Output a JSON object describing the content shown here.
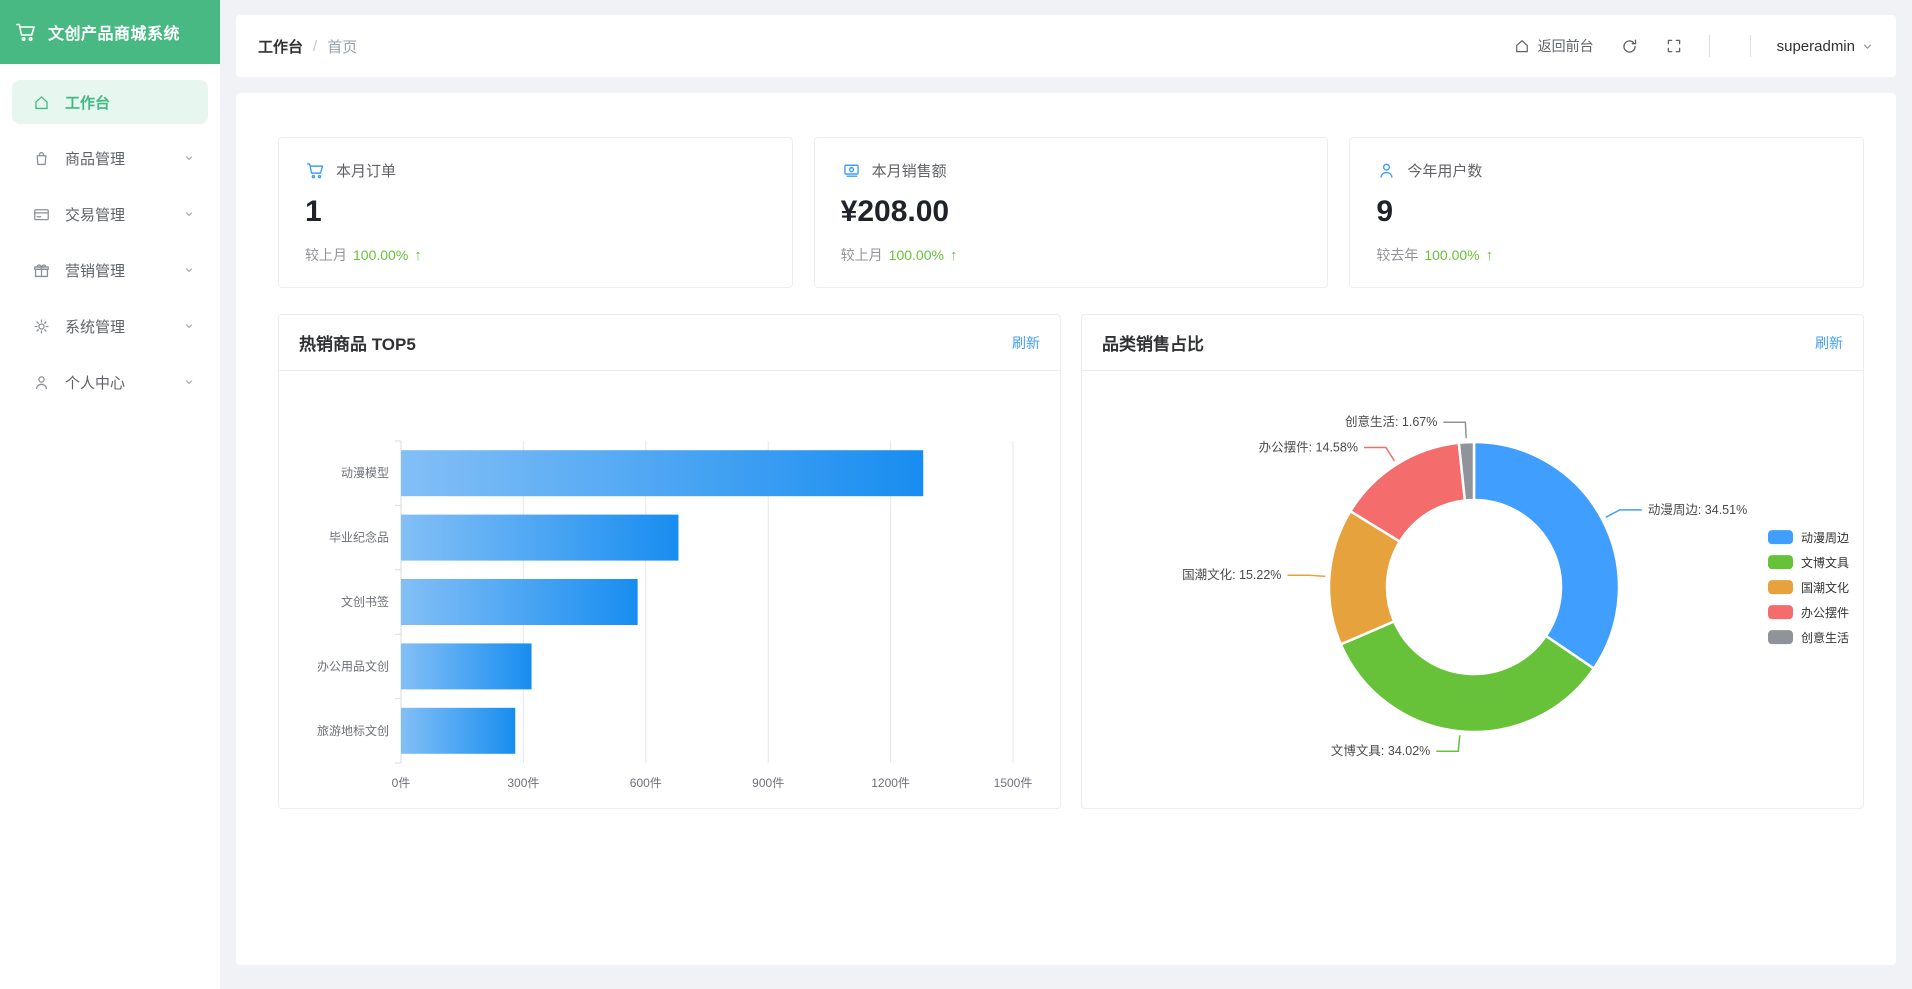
{
  "app": {
    "title": "文创产品商城系统"
  },
  "sidebar": {
    "items": [
      {
        "label": "工作台",
        "active": true,
        "expandable": false
      },
      {
        "label": "商品管理",
        "active": false,
        "expandable": true
      },
      {
        "label": "交易管理",
        "active": false,
        "expandable": true
      },
      {
        "label": "营销管理",
        "active": false,
        "expandable": true
      },
      {
        "label": "系统管理",
        "active": false,
        "expandable": true
      },
      {
        "label": "个人中心",
        "active": false,
        "expandable": true
      }
    ]
  },
  "header": {
    "breadcrumb": {
      "section": "工作台",
      "separator": "/",
      "page": "首页"
    },
    "back_home": "返回前台",
    "username": "superadmin"
  },
  "stats": [
    {
      "icon": "cart-icon",
      "title": "本月订单",
      "value": "1",
      "compare_label": "较上月",
      "compare_value": "100.00%",
      "trend": "up"
    },
    {
      "icon": "money-icon",
      "title": "本月销售额",
      "value": "¥208.00",
      "compare_label": "较上月",
      "compare_value": "100.00%",
      "trend": "up"
    },
    {
      "icon": "user-icon",
      "title": "今年用户数",
      "value": "9",
      "compare_label": "较去年",
      "compare_value": "100.00%",
      "trend": "up"
    }
  ],
  "panels": [
    {
      "title": "热销商品 TOP5",
      "action": "刷新"
    },
    {
      "title": "品类销售占比",
      "action": "刷新"
    }
  ],
  "chart_data": [
    {
      "type": "bar",
      "orientation": "horizontal",
      "title": "热销商品 TOP5",
      "categories": [
        "动漫模型",
        "毕业纪念品",
        "文创书签",
        "办公用品文创",
        "旅游地标文创"
      ],
      "values": [
        1280,
        680,
        580,
        320,
        280
      ],
      "unit": "件",
      "xlim": [
        0,
        1500
      ],
      "xticks": [
        0,
        300,
        600,
        900,
        1200,
        1500
      ],
      "grid": true,
      "bar_gradient": [
        "#83bff6",
        "#188df0"
      ],
      "axis_color": "#d7dbe3",
      "grid_color": "#e4e7f0",
      "label_color": "#6e7079"
    },
    {
      "type": "pie",
      "donut": true,
      "title": "品类销售占比",
      "legend_position": "right",
      "label_format": "name: pct%",
      "items": [
        {
          "name": "动漫周边",
          "pct": 34.51,
          "color": "#409EFF"
        },
        {
          "name": "文博文具",
          "pct": 34.02,
          "color": "#67C23A"
        },
        {
          "name": "国潮文化",
          "pct": 15.22,
          "color": "#E6A23C"
        },
        {
          "name": "办公摆件",
          "pct": 14.58,
          "color": "#F56C6C"
        },
        {
          "name": "创意生活",
          "pct": 1.67,
          "color": "#909399"
        }
      ]
    }
  ],
  "colors": {
    "brand_green": "#49B984",
    "active_bg": "#E7F6EE",
    "accent_blue": "#409EFF",
    "success_green": "#67C23A",
    "page_bg": "#F0F2F5"
  }
}
